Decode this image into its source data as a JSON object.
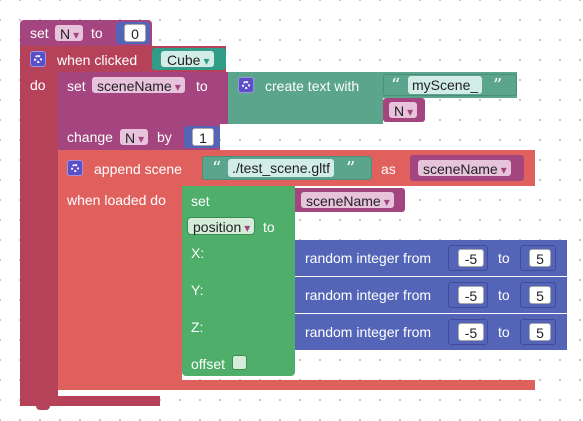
{
  "colors": {
    "variables": "#a5457f",
    "events": "#b6425a",
    "scene": "#e0605d",
    "text": "#5ba58c",
    "objects": "#4fae6a",
    "math": "#5465b8"
  },
  "set_n_block": {
    "set": "set",
    "var": "N",
    "to": "to",
    "value": "0"
  },
  "when_clicked_block": {
    "label": "when clicked",
    "object": "Cube",
    "do": "do"
  },
  "set_scene_name_block": {
    "set": "set",
    "var": "sceneName",
    "to": "to"
  },
  "create_text_block": {
    "label": "create text with",
    "text": "myScene_",
    "var": "N"
  },
  "change_block": {
    "label": "change",
    "var": "N",
    "by": "by",
    "value": "1"
  },
  "append_scene_block": {
    "label": "append scene",
    "file": "./test_scene.gltf",
    "as": "as",
    "var": "sceneName",
    "when_loaded": "when loaded do"
  },
  "set_position_block": {
    "set": "set",
    "var": "sceneName",
    "property": "position",
    "to": "to",
    "x_label": "X:",
    "y_label": "Y:",
    "z_label": "Z:",
    "offset_label": "offset"
  },
  "random_blocks": [
    {
      "label": "random integer from",
      "from": "-5",
      "to_label": "to",
      "to": "5"
    },
    {
      "label": "random integer from",
      "from": "-5",
      "to_label": "to",
      "to": "5"
    },
    {
      "label": "random integer from",
      "from": "-5",
      "to_label": "to",
      "to": "5"
    }
  ]
}
